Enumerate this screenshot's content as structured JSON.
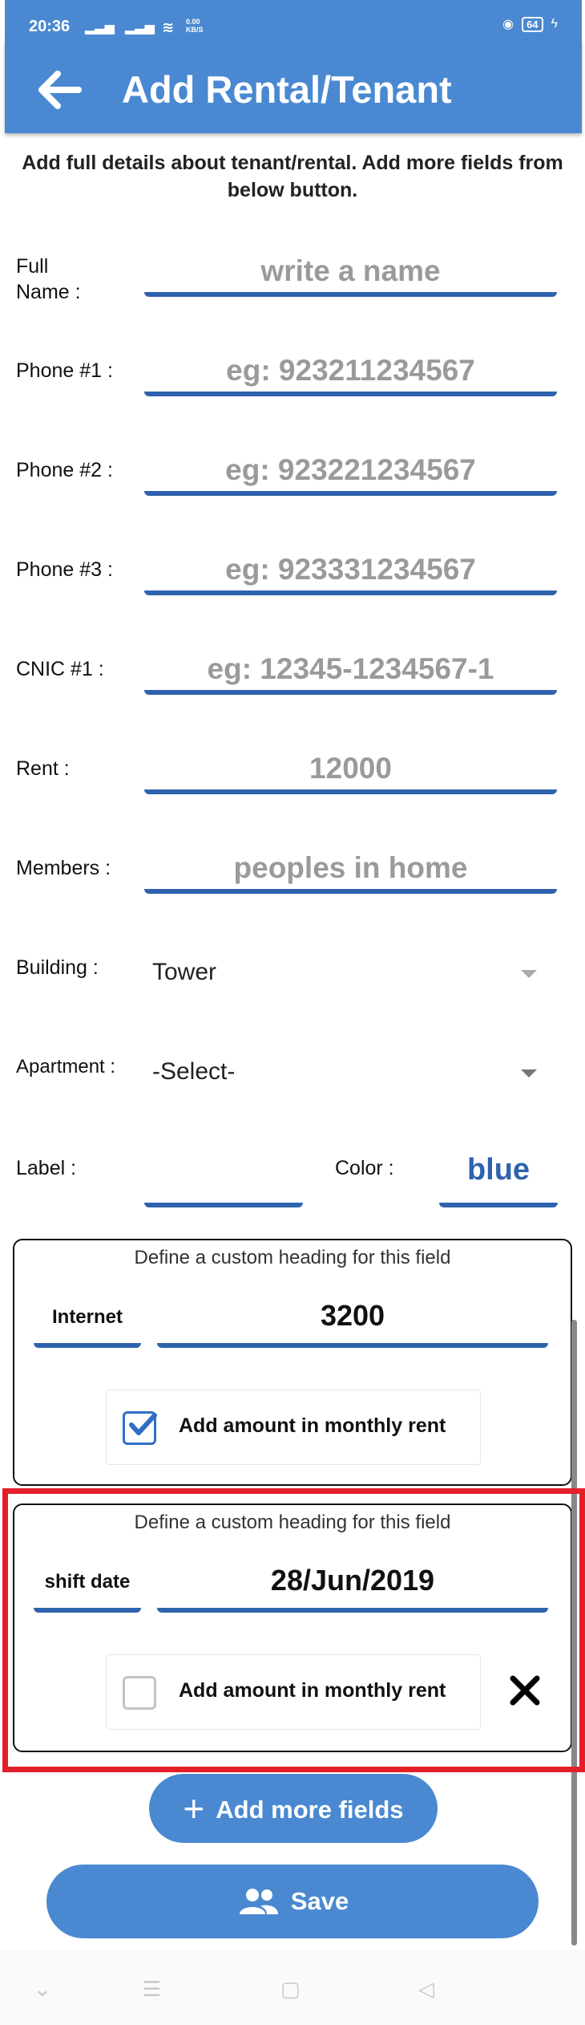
{
  "status": {
    "time": "20:36",
    "speed": "0.00 KB/S",
    "battery": "64"
  },
  "appbar": {
    "title": "Add Rental/Tenant"
  },
  "intro": "Add full details about tenant/rental. Add more fields from below button.",
  "form": {
    "full_name": {
      "label": "Full Name :",
      "placeholder": "write a name"
    },
    "phone1": {
      "label": "Phone #1 :",
      "placeholder": "eg: 923211234567"
    },
    "phone2": {
      "label": "Phone #2 :",
      "placeholder": "eg: 923221234567"
    },
    "phone3": {
      "label": "Phone #3 :",
      "placeholder": "eg: 923331234567"
    },
    "cnic": {
      "label": "CNIC #1 :",
      "placeholder": "eg: 12345-1234567-1"
    },
    "rent": {
      "label": "Rent :",
      "placeholder": "12000"
    },
    "members": {
      "label": "Members :",
      "placeholder": "peoples in home"
    },
    "building": {
      "label": "Building :",
      "value": "Tower"
    },
    "apartment": {
      "label": "Apartment :",
      "value": "-Select-"
    },
    "label_field": {
      "label": "Label :",
      "value": ""
    },
    "color_field": {
      "label": "Color :",
      "value": "blue"
    }
  },
  "custom_fields": [
    {
      "heading_hint": "Define a custom heading for this field",
      "heading": "Internet",
      "value": "3200",
      "checkbox_label": "Add amount in monthly rent",
      "checked": true
    },
    {
      "heading_hint": "Define a custom heading for this field",
      "heading": "shift date",
      "value": "28/Jun/2019",
      "checkbox_label": "Add amount in monthly rent",
      "checked": false
    }
  ],
  "buttons": {
    "add_more": "Add more fields",
    "save": "Save"
  },
  "icons": [
    "back-arrow-icon",
    "check-icon",
    "close-icon",
    "plus-icon",
    "people-icon"
  ],
  "colors": {
    "primary": "#4a89d1",
    "underline": "#2e62ad",
    "highlight": "#e3202a"
  }
}
